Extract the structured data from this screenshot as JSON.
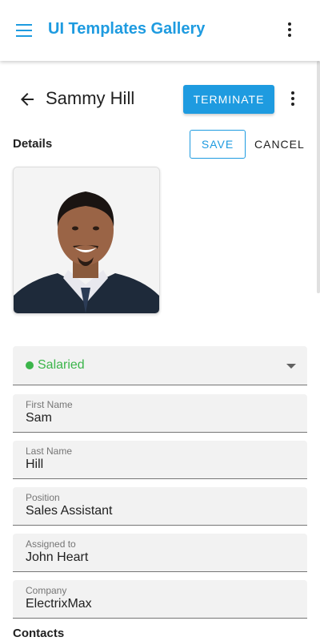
{
  "app": {
    "title": "UI Templates Gallery"
  },
  "header": {
    "name": "Sammy Hill",
    "terminate_label": "TERMINATE"
  },
  "details": {
    "label": "Details",
    "save_label": "SAVE",
    "cancel_label": "CANCEL"
  },
  "status": {
    "value": "Salaried",
    "color": "#3bb54a"
  },
  "fields": [
    {
      "label": "First Name",
      "value": "Sam"
    },
    {
      "label": "Last Name",
      "value": "Hill"
    },
    {
      "label": "Position",
      "value": "Sales Assistant"
    },
    {
      "label": "Assigned to",
      "value": "John Heart"
    },
    {
      "label": "Company",
      "value": "ElectrixMax"
    }
  ],
  "contacts": {
    "label": "Contacts"
  },
  "colors": {
    "accent": "#1e9be0",
    "status_green": "#3bb54a"
  }
}
